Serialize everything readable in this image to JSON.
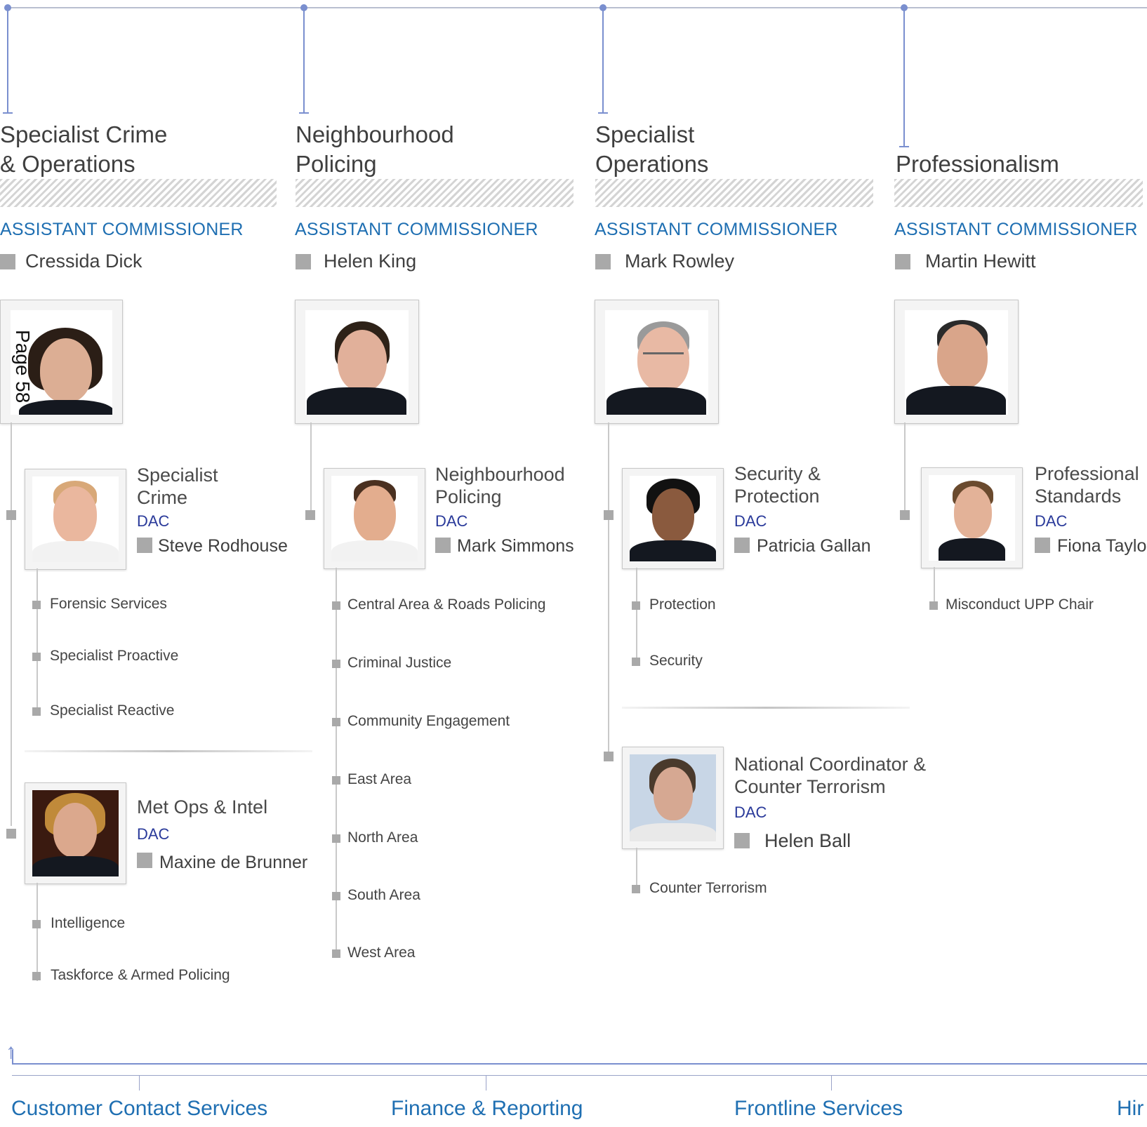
{
  "columns": [
    {
      "title": [
        "Specialist Crime",
        "& Operations"
      ],
      "role": "ASSISTANT COMMISSIONER",
      "name": "Cressida Dick",
      "deputies": [
        {
          "title": [
            "Specialist",
            "Crime"
          ],
          "role": "DAC",
          "name": "Steve Rodhouse",
          "units": [
            "Forensic Services",
            "Specialist Proactive",
            "Specialist Reactive"
          ]
        },
        {
          "title": [
            "Met Ops & Intel"
          ],
          "role": "DAC",
          "name": "Maxine de Brunner",
          "units": [
            "Intelligence",
            "Taskforce & Armed Policing"
          ]
        }
      ]
    },
    {
      "title": [
        "Neighbourhood",
        "Policing"
      ],
      "role": "ASSISTANT COMMISSIONER",
      "name": "Helen King",
      "deputies": [
        {
          "title": [
            "Neighbourhood",
            "Policing"
          ],
          "role": "DAC",
          "name": "Mark Simmons",
          "units": [
            "Central Area & Roads Policing",
            "Criminal Justice",
            "Community Engagement",
            "East Area",
            "North Area",
            "South Area",
            "West Area"
          ]
        }
      ]
    },
    {
      "title": [
        "Specialist",
        "Operations"
      ],
      "role": "ASSISTANT COMMISSIONER",
      "name": "Mark Rowley",
      "deputies": [
        {
          "title": [
            "Security &",
            "Protection"
          ],
          "role": "DAC",
          "name": "Patricia Gallan",
          "units": [
            "Protection",
            "Security"
          ]
        },
        {
          "title": [
            "National Coordinator &",
            "Counter Terrorism"
          ],
          "role": "DAC",
          "name": "Helen Ball",
          "units": [
            "Counter Terrorism"
          ]
        }
      ]
    },
    {
      "title": [
        "",
        "Professionalism"
      ],
      "role": "ASSISTANT COMMISSIONER",
      "name": "Martin Hewitt",
      "deputies": [
        {
          "title": [
            "Professional",
            "Standards"
          ],
          "role": "DAC",
          "name": "Fiona Taylo",
          "units": [
            "Misconduct UPP Chair"
          ]
        }
      ]
    }
  ],
  "page_label": "Page 58",
  "bottom_labels": [
    "Customer Contact Services",
    "Finance & Reporting",
    "Frontline Services",
    "Hir"
  ],
  "colors": {
    "accent_blue": "#1f6fb2",
    "dac_blue": "#2a3a9a",
    "line_blue": "#7a8fcf",
    "square_grey": "#a9a9a9"
  },
  "icons": {
    "portrait": "person-photo",
    "bullet": "grey-square-bullet",
    "arrow": "up-arrow-icon"
  }
}
